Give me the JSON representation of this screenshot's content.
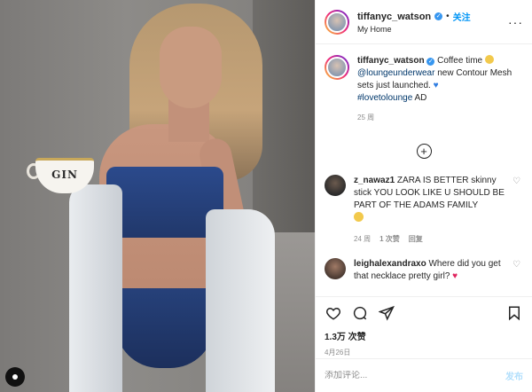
{
  "photo": {
    "cup_text": "GIN"
  },
  "header": {
    "username": "tiffanyc_watson",
    "dot": "•",
    "follow_label": "关注",
    "location": "My Home",
    "more_icon": "more-horizontal-icon"
  },
  "caption": {
    "username": "tiffanyc_watson",
    "text_1": "Coffee time",
    "mention": "@loungeunderwear",
    "text_2": "new Contour Mesh sets just launched.",
    "hashtag": "#lovetolounge",
    "text_3": "AD",
    "time": "25 周"
  },
  "load_more_icon": "plus-circle-icon",
  "comments": [
    {
      "username": "z_nawaz1",
      "text": "ZARA IS BETTER skinny stick YOU LOOK LIKE U SHOULD BE PART OF THE ADAMS FAMILY",
      "time": "24 周",
      "likes": "1 次赞",
      "reply": "回复"
    },
    {
      "username": "leighalexandraxo",
      "text": "Where did you get that necklace pretty girl?"
    }
  ],
  "actions": {
    "like_icon": "heart-icon",
    "comment_icon": "comment-icon",
    "share_icon": "share-icon",
    "save_icon": "bookmark-icon"
  },
  "likes": "1.3万 次赞",
  "date": "4月26日",
  "add_comment": {
    "placeholder": "添加评论...",
    "post_label": "发布"
  },
  "colors": {
    "link_blue": "#0095f6",
    "verified_blue": "#3897f0",
    "meta_gray": "#8e8e8e",
    "text_dark": "#262626",
    "post_disabled": "#b2dffc"
  }
}
